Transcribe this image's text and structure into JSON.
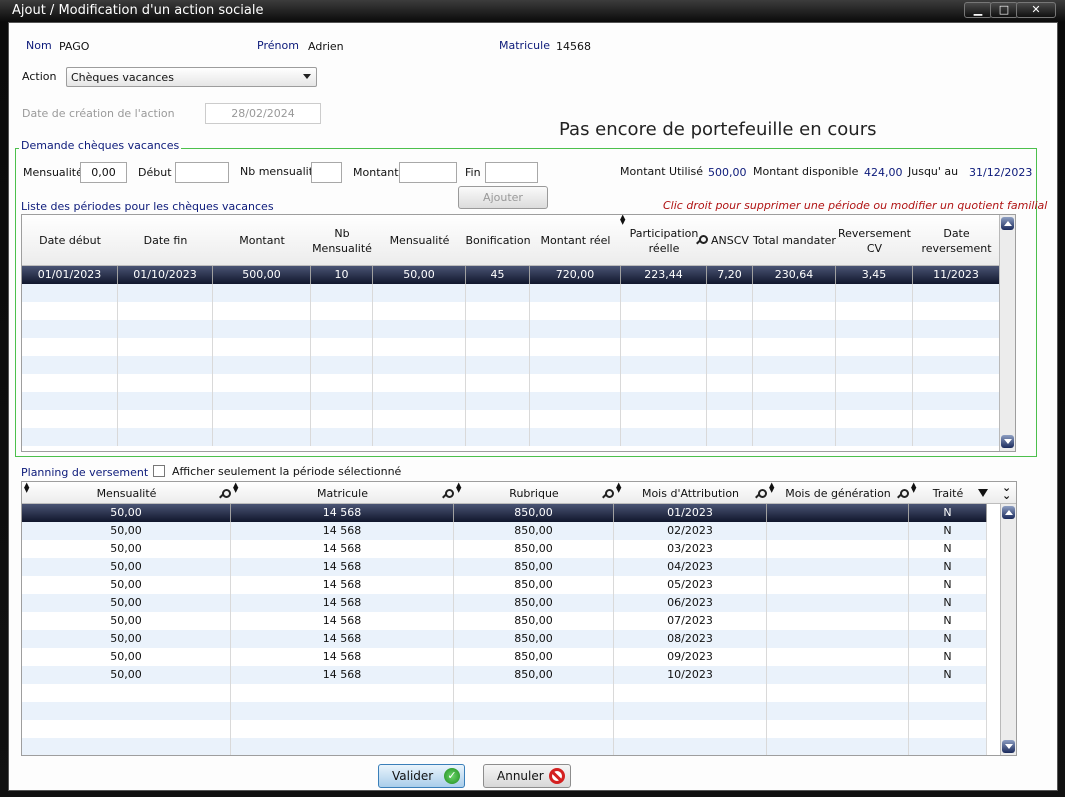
{
  "window": {
    "title": "Ajout / Modification d'un action sociale",
    "min_symbol": "▁",
    "max_symbol": "□",
    "close_symbol": "✕"
  },
  "person": {
    "nom_label": "Nom",
    "nom": "PAGO",
    "prenom_label": "Prénom",
    "prenom": "Adrien",
    "matricule_label": "Matricule",
    "matricule": "14568"
  },
  "action": {
    "label": "Action",
    "value": "Chèques vacances"
  },
  "creation": {
    "label": "Date de création de l'action",
    "value": "28/02/2024"
  },
  "headline": "Pas encore de portefeuille en cours",
  "demande": {
    "legend": "Demande chèques vacances",
    "mensualite_label": "Mensualité",
    "mensualite_value": "0,00",
    "debut_label": "Début",
    "debut_value": "",
    "nb_mensualite_label": "Nb mensualité",
    "nb_mensualite_value": "",
    "montant_label": "Montant",
    "montant_value": "",
    "fin_label": "Fin",
    "fin_value": "",
    "montant_utilise_label": "Montant Utilisé",
    "montant_utilise": "500,00",
    "montant_disponible_label": "Montant disponible",
    "montant_disponible": "424,00",
    "jusqu_au_label": "Jusqu' au",
    "jusqu_au": "31/12/2023",
    "ajouter_label": "Ajouter"
  },
  "periodes": {
    "title": "Liste des périodes pour les chèques vacances",
    "hint": "Clic droit pour supprimer une période ou modifier un quotient familial",
    "columns": [
      "Date début",
      "Date fin",
      "Montant",
      "Nb\nMensualité",
      "Mensualité",
      "Bonification",
      "Montant  réel",
      "Participation\nréelle",
      "ANSCV",
      "Total mandater",
      "Reversement\nCV",
      "Date\nreversement"
    ],
    "rows": [
      [
        "01/01/2023",
        "01/10/2023",
        "500,00",
        "10",
        "50,00",
        "45",
        "720,00",
        "223,44",
        "7,20",
        "230,64",
        "3,45",
        "11/2023"
      ]
    ]
  },
  "planning": {
    "title": "Planning de versement",
    "checkbox_label": "Afficher seulement la période sélectionné",
    "columns": [
      "Mensualité",
      "Matricule",
      "Rubrique",
      "Mois d'Attribution",
      "Mois de génération",
      "Traité"
    ],
    "rows": [
      [
        "50,00",
        "14 568",
        "850,00",
        "01/2023",
        "",
        "N"
      ],
      [
        "50,00",
        "14 568",
        "850,00",
        "02/2023",
        "",
        "N"
      ],
      [
        "50,00",
        "14 568",
        "850,00",
        "03/2023",
        "",
        "N"
      ],
      [
        "50,00",
        "14 568",
        "850,00",
        "04/2023",
        "",
        "N"
      ],
      [
        "50,00",
        "14 568",
        "850,00",
        "05/2023",
        "",
        "N"
      ],
      [
        "50,00",
        "14 568",
        "850,00",
        "06/2023",
        "",
        "N"
      ],
      [
        "50,00",
        "14 568",
        "850,00",
        "07/2023",
        "",
        "N"
      ],
      [
        "50,00",
        "14 568",
        "850,00",
        "08/2023",
        "",
        "N"
      ],
      [
        "50,00",
        "14 568",
        "850,00",
        "09/2023",
        "",
        "N"
      ],
      [
        "50,00",
        "14 568",
        "850,00",
        "10/2023",
        "",
        "N"
      ]
    ]
  },
  "buttons": {
    "valider": "Valider",
    "annuler": "Annuler"
  }
}
